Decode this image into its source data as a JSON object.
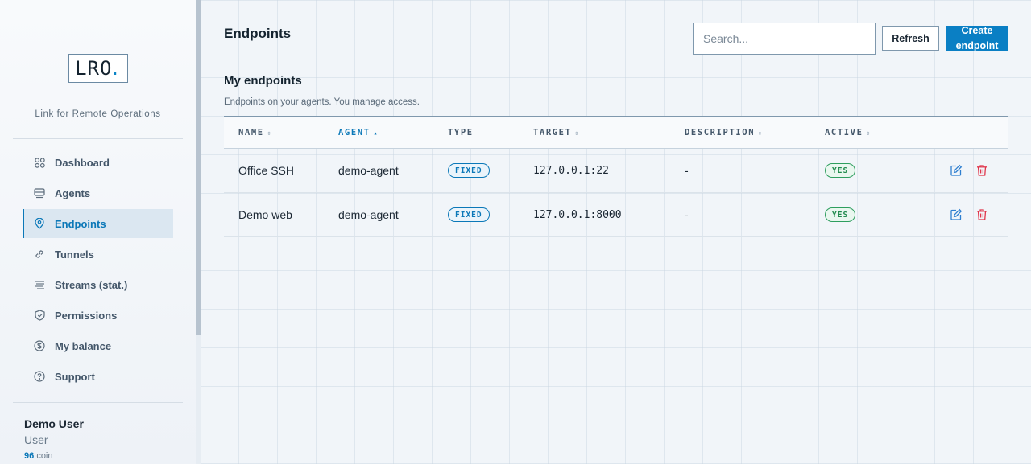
{
  "brand": {
    "logo_text": "LRO",
    "logo_dot": ".",
    "tagline": "Link for Remote Operations"
  },
  "sidebar": {
    "items": [
      {
        "label": "Dashboard",
        "icon": "dashboard-icon",
        "active": false
      },
      {
        "label": "Agents",
        "icon": "agents-icon",
        "active": false
      },
      {
        "label": "Endpoints",
        "icon": "location-pin-icon",
        "active": true
      },
      {
        "label": "Tunnels",
        "icon": "link-icon",
        "active": false
      },
      {
        "label": "Streams (stat.)",
        "icon": "streams-icon",
        "active": false
      },
      {
        "label": "Permissions",
        "icon": "shield-icon",
        "active": false
      },
      {
        "label": "My balance",
        "icon": "dollar-icon",
        "active": false
      },
      {
        "label": "Support",
        "icon": "help-icon",
        "active": false
      }
    ]
  },
  "user": {
    "name": "Demo User",
    "role": "User",
    "balance": "96",
    "balance_unit": "coin"
  },
  "header": {
    "title": "Endpoints",
    "search_placeholder": "Search...",
    "refresh_label": "Refresh",
    "create_label": "Create\nendpoint"
  },
  "section": {
    "title": "My endpoints",
    "subtitle": "Endpoints on your agents. You manage access."
  },
  "table": {
    "columns": [
      "NAME",
      "AGENT",
      "TYPE",
      "TARGET",
      "DESCRIPTION",
      "ACTIVE"
    ],
    "sort_column": "AGENT",
    "sort_glyph": "▴",
    "unsorted_glyph": "⇕",
    "rows": [
      {
        "name": "Office SSH",
        "agent": "demo-agent",
        "type": "FIXED",
        "target": "127.0.0.1:22",
        "description": "-",
        "active": "YES"
      },
      {
        "name": "Demo web",
        "agent": "demo-agent",
        "type": "FIXED",
        "target": "127.0.0.1:8000",
        "description": "-",
        "active": "YES"
      }
    ]
  },
  "colors": {
    "accent": "#0a7fc4",
    "success": "#1f8a4c",
    "danger": "#e0344a",
    "edit": "#2f7fd0"
  }
}
